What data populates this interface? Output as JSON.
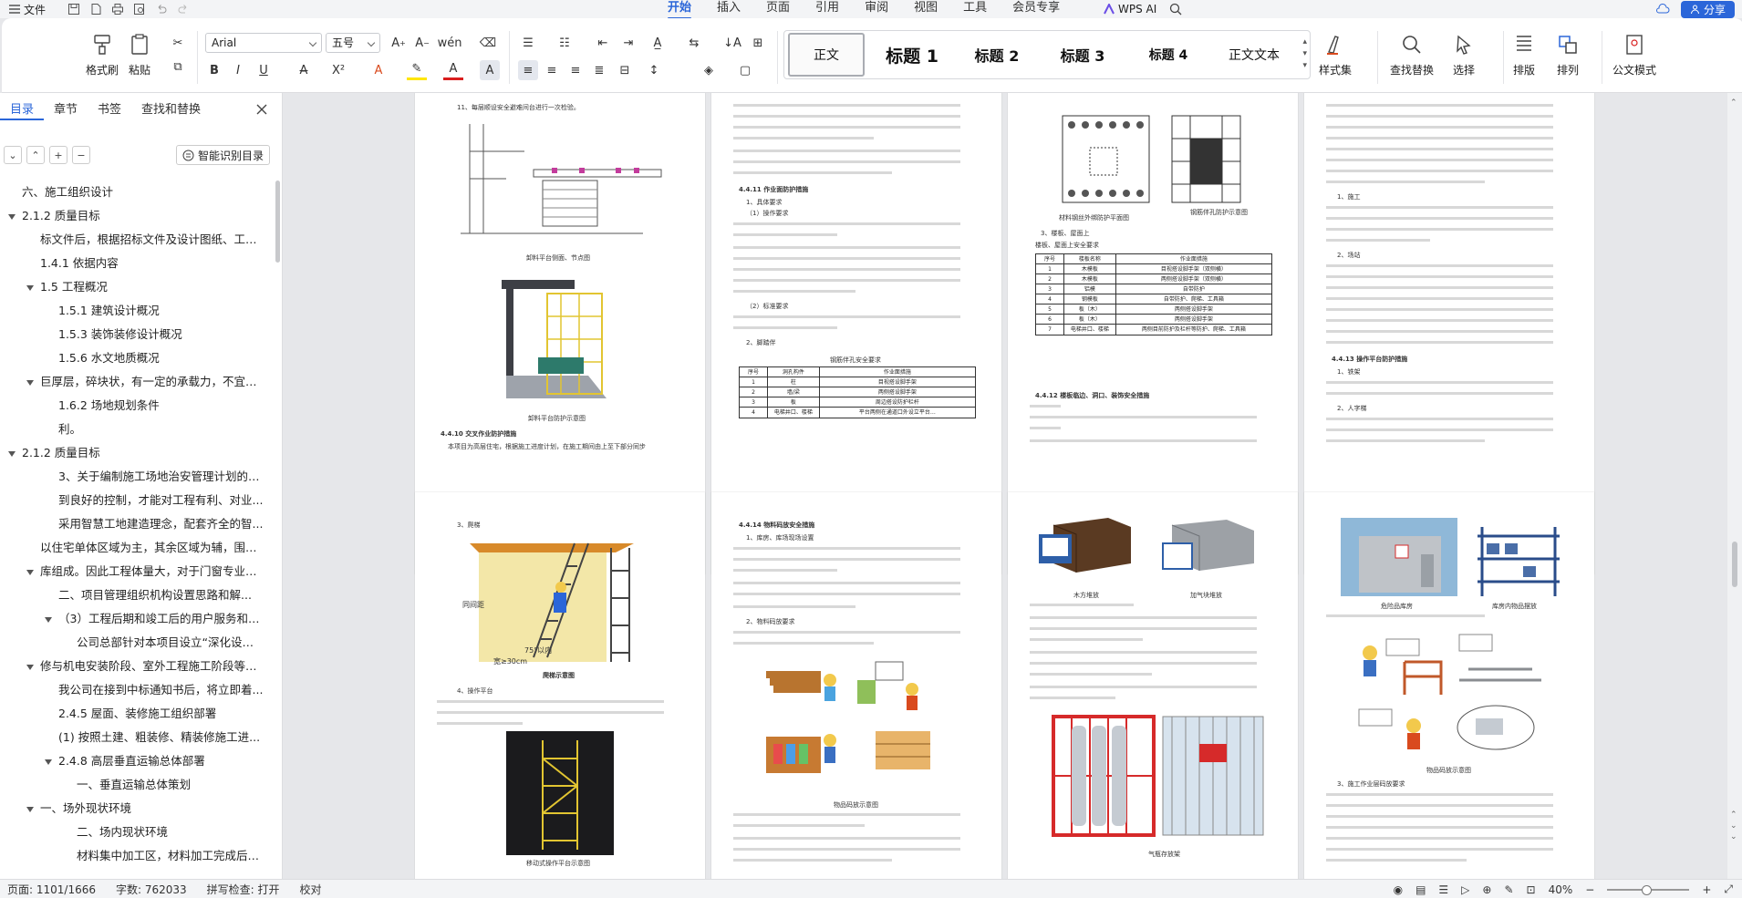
{
  "menubar": {
    "file_label": "文件",
    "tabs": [
      {
        "label": "开始",
        "active": true
      },
      {
        "label": "插入"
      },
      {
        "label": "页面"
      },
      {
        "label": "引用"
      },
      {
        "label": "审阅"
      },
      {
        "label": "视图"
      },
      {
        "label": "工具"
      },
      {
        "label": "会员专享"
      }
    ],
    "wps_ai": "WPS AI",
    "share": "分享"
  },
  "ribbon": {
    "format_painter": "格式刷",
    "paste": "粘贴",
    "font": "Arial",
    "font_size": "五号",
    "styles": [
      "正文",
      "标题 1",
      "标题 2",
      "标题 3",
      "标题 4",
      "正文文本"
    ],
    "style_set": "样式集",
    "find_replace": "查找替换",
    "select": "选择",
    "layout": "排版",
    "arrange": "排列",
    "doc_mode": "公文模式"
  },
  "nav": {
    "tabs": [
      "目录",
      "章节",
      "书签",
      "查找和替换"
    ],
    "smart_toc": "智能识别目录",
    "items": [
      {
        "level": 0,
        "caret": false,
        "text": "六、施工组织设计"
      },
      {
        "level": 0,
        "caret": true,
        "text": "2.1.2 质量目标"
      },
      {
        "level": 1,
        "caret": false,
        "text": "标文件后，根据招标文件及设计图纸、工程..."
      },
      {
        "level": 1,
        "caret": false,
        "text": "1.4.1 依据内容"
      },
      {
        "level": 1,
        "caret": true,
        "text": "1.5 工程概况"
      },
      {
        "level": 2,
        "caret": false,
        "text": "1.5.1 建筑设计概况"
      },
      {
        "level": 2,
        "caret": false,
        "text": "1.5.3 装饰装修设计概况"
      },
      {
        "level": 2,
        "caret": false,
        "text": "1.5.6 水文地质概况"
      },
      {
        "level": 1,
        "caret": true,
        "text": "巨厚层，碎块状，有一定的承载力，不宜作..."
      },
      {
        "level": 2,
        "caret": false,
        "text": "1.6.2 场地规划条件"
      },
      {
        "level": 2,
        "caret": false,
        "text": "利。"
      },
      {
        "level": 0,
        "caret": true,
        "text": "2.1.2 质量目标"
      },
      {
        "level": 2,
        "caret": false,
        "text": "3、关于编制施工场地治安管理计划的约..."
      },
      {
        "level": 2,
        "caret": false,
        "text": "到良好的控制，才能对工程有利、对业..."
      },
      {
        "level": 2,
        "caret": false,
        "text": "采用智慧工地建造理念，配套齐全的智..."
      },
      {
        "level": 1,
        "caret": false,
        "text": "以住宅单体区域为主，其余区域为辅，围绕..."
      },
      {
        "level": 1,
        "caret": true,
        "text": "库组成。因此工程体量大，对于门窗专业、..."
      },
      {
        "level": 2,
        "caret": false,
        "text": "二、项目管理组织机构设置思路和解..."
      },
      {
        "level": 2,
        "caret": true,
        "text": "（3）工程后期和竣工后的用户服务和保..."
      },
      {
        "level": 3,
        "caret": false,
        "text": "公司总部针对本项目设立“深化设计..."
      },
      {
        "level": 1,
        "caret": true,
        "text": "修与机电安装阶段、室外工程施工阶段等不..."
      },
      {
        "level": 2,
        "caret": false,
        "text": "我公司在接到中标通知书后，将立即着..."
      },
      {
        "level": 2,
        "caret": false,
        "text": "2.4.5 屋面、装修施工组织部署"
      },
      {
        "level": 2,
        "caret": false,
        "text": "(1) 按照土建、粗装修、精装修施工进..."
      },
      {
        "level": 2,
        "caret": true,
        "text": "2.4.8 高层垂直运输总体部署"
      },
      {
        "level": 3,
        "caret": false,
        "text": "一、垂直运输总体策划"
      },
      {
        "level": 1,
        "caret": true,
        "text": "一、场外现状环境"
      },
      {
        "level": 3,
        "caret": false,
        "text": "二、场内现状环境"
      },
      {
        "level": 3,
        "caret": false,
        "text": "材料集中加工区，材料加工完成后，..."
      }
    ]
  },
  "pages": {
    "p1": {
      "top": "11、每层顺设安全避难间台进行一次检验。",
      "cap1": "卸料平台侧面、节点图",
      "cap2": "卸料平台防护示意图",
      "head": "4.4.10 交叉作业防护措施",
      "line": "本项目为高层住宅，根据施工进度计划，在施工期间由上至下部分同步"
    },
    "p2": {
      "head1": "4.4.11 作业面防护措施",
      "l1": "1、具体要求",
      "l2": "（1）操作要求",
      "l3": "（2）标准要求",
      "l4": "2、脚踏伴",
      "tcap": "钢筋伴孔安全要求",
      "th": [
        "序号",
        "洞孔构件",
        "作业面措施"
      ],
      "rows": [
        [
          "1",
          "柱",
          "目视搭设脚手架"
        ],
        [
          "2",
          "墙/梁",
          "两侧搭设脚手架"
        ],
        [
          "3",
          "板",
          "周边搭设防护栏杆"
        ],
        [
          "4",
          "电梯井口、楼梯",
          "平台两侧在通道口外设立平台…"
        ]
      ]
    },
    "p3": {
      "c1": "材料钢丝外绑防护平面图",
      "c2": "钢筋伴孔防护示意图",
      "l1": "3、楼板、屋面上",
      "l2": "楼板、屋面上安全要求",
      "th": [
        "序号",
        "楼板名称",
        "作业面措施"
      ],
      "rows": [
        [
          "1",
          "木模板",
          "目视搭设脚手架（双侧横）"
        ],
        [
          "2",
          "木模板",
          "两侧搭设脚手架（双侧横）"
        ],
        [
          "3",
          "铝模",
          "自带防护"
        ],
        [
          "4",
          "钢模板",
          "自带防护、爬梯、工具箱"
        ],
        [
          "5",
          "板（木）",
          "两侧搭设脚手架"
        ],
        [
          "6",
          "板（木）",
          "两侧搭设脚手架"
        ],
        [
          "7",
          "电梯井口、楼梯",
          "两侧目前防护及栏杆等防护、爬梯、工具箱"
        ]
      ],
      "head": "4.4.12 楼板临边、洞口、装饰安全措施"
    },
    "p4": {
      "l1": "1、施工",
      "l2": "2、场站",
      "head": "4.4.13 操作平台防护措施",
      "l3": "1、铁架",
      "l4": "2、人字梯"
    },
    "p5": {
      "l1": "3、爬梯",
      "w1": "同间距",
      "w2": "75°以内",
      "w3": "宽≥30cm",
      "cap": "爬梯示意图",
      "l2": "4、操作平台",
      "cap2": "移动式操作平台示意图"
    },
    "p6": {
      "head": "4.4.14 物料码放安全措施",
      "l1": "1、库房、库场现场设置",
      "l2": "2、物料码放要求",
      "cap": "物品码放示意图"
    },
    "p7": {
      "c1": "木方堆放",
      "c2": "加气块堆放",
      "cap": "气瓶存放架"
    },
    "p8": {
      "c1": "危险品库房",
      "c2": "库房内物品摆放",
      "cap": "物品码放示意图",
      "l1": "3、施工作业层码放要求"
    }
  },
  "status": {
    "page": "页面: 1101/1666",
    "words": "字数: 762033",
    "spell": "拼写检查: 打开",
    "proof": "校对",
    "zoom": "40%"
  }
}
